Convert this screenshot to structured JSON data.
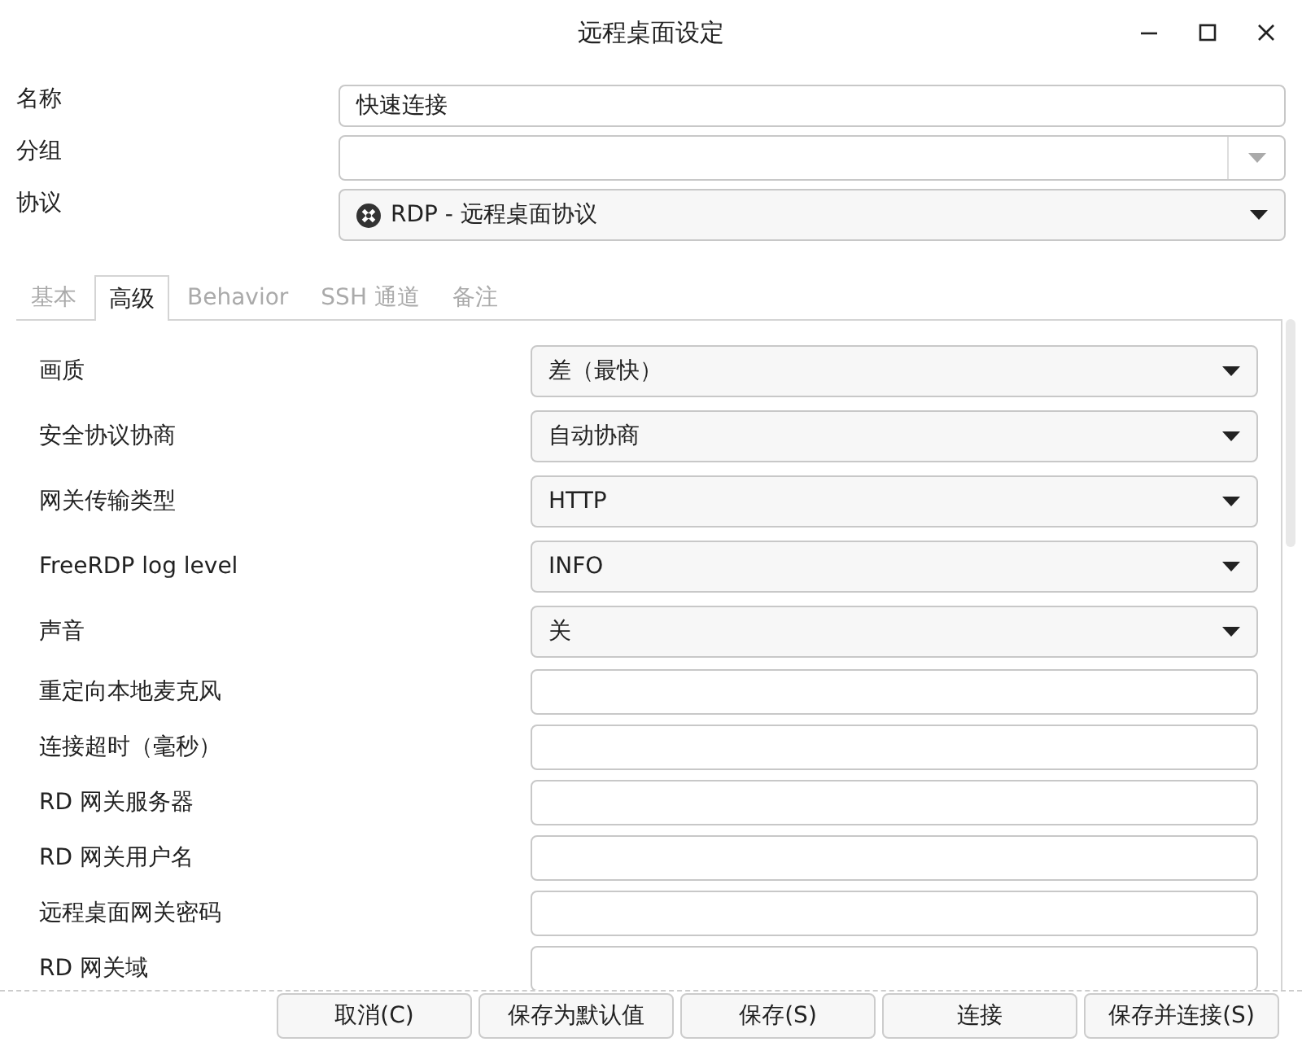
{
  "window": {
    "title": "远程桌面设定"
  },
  "fields": [
    {
      "label": "名称",
      "kind": "text",
      "value": "快速连接"
    },
    {
      "label": "分组",
      "kind": "combo"
    },
    {
      "label": "协议",
      "kind": "select",
      "value": "RDP - 远程桌面协议"
    }
  ],
  "tabs": [
    {
      "label": "基本",
      "selected": false
    },
    {
      "label": "高级",
      "selected": true
    },
    {
      "label": "Behavior",
      "selected": false
    },
    {
      "label": "SSH 通道",
      "selected": false
    },
    {
      "label": "备注",
      "selected": false
    }
  ],
  "settings": [
    {
      "label": "画质",
      "kind": "select",
      "value": "差（最快）"
    },
    {
      "label": "安全协议协商",
      "kind": "select",
      "value": "自动协商"
    },
    {
      "label": "网关传输类型",
      "kind": "select",
      "value": "HTTP"
    },
    {
      "label": "FreeRDP log level",
      "kind": "select",
      "value": "INFO"
    },
    {
      "label": "声音",
      "kind": "select",
      "value": "关"
    },
    {
      "label": "重定向本地麦克风",
      "kind": "text"
    },
    {
      "label": "连接超时（毫秒）",
      "kind": "text"
    },
    {
      "label": "RD 网关服务器",
      "kind": "text"
    },
    {
      "label": "RD 网关用户名",
      "kind": "text"
    },
    {
      "label": "远程桌面网关密码",
      "kind": "text"
    },
    {
      "label": "RD 网关域",
      "kind": "text"
    }
  ],
  "buttons": [
    "取消(C)",
    "保存为默认值",
    "保存(S)",
    "连接",
    "保存并连接(S)"
  ]
}
